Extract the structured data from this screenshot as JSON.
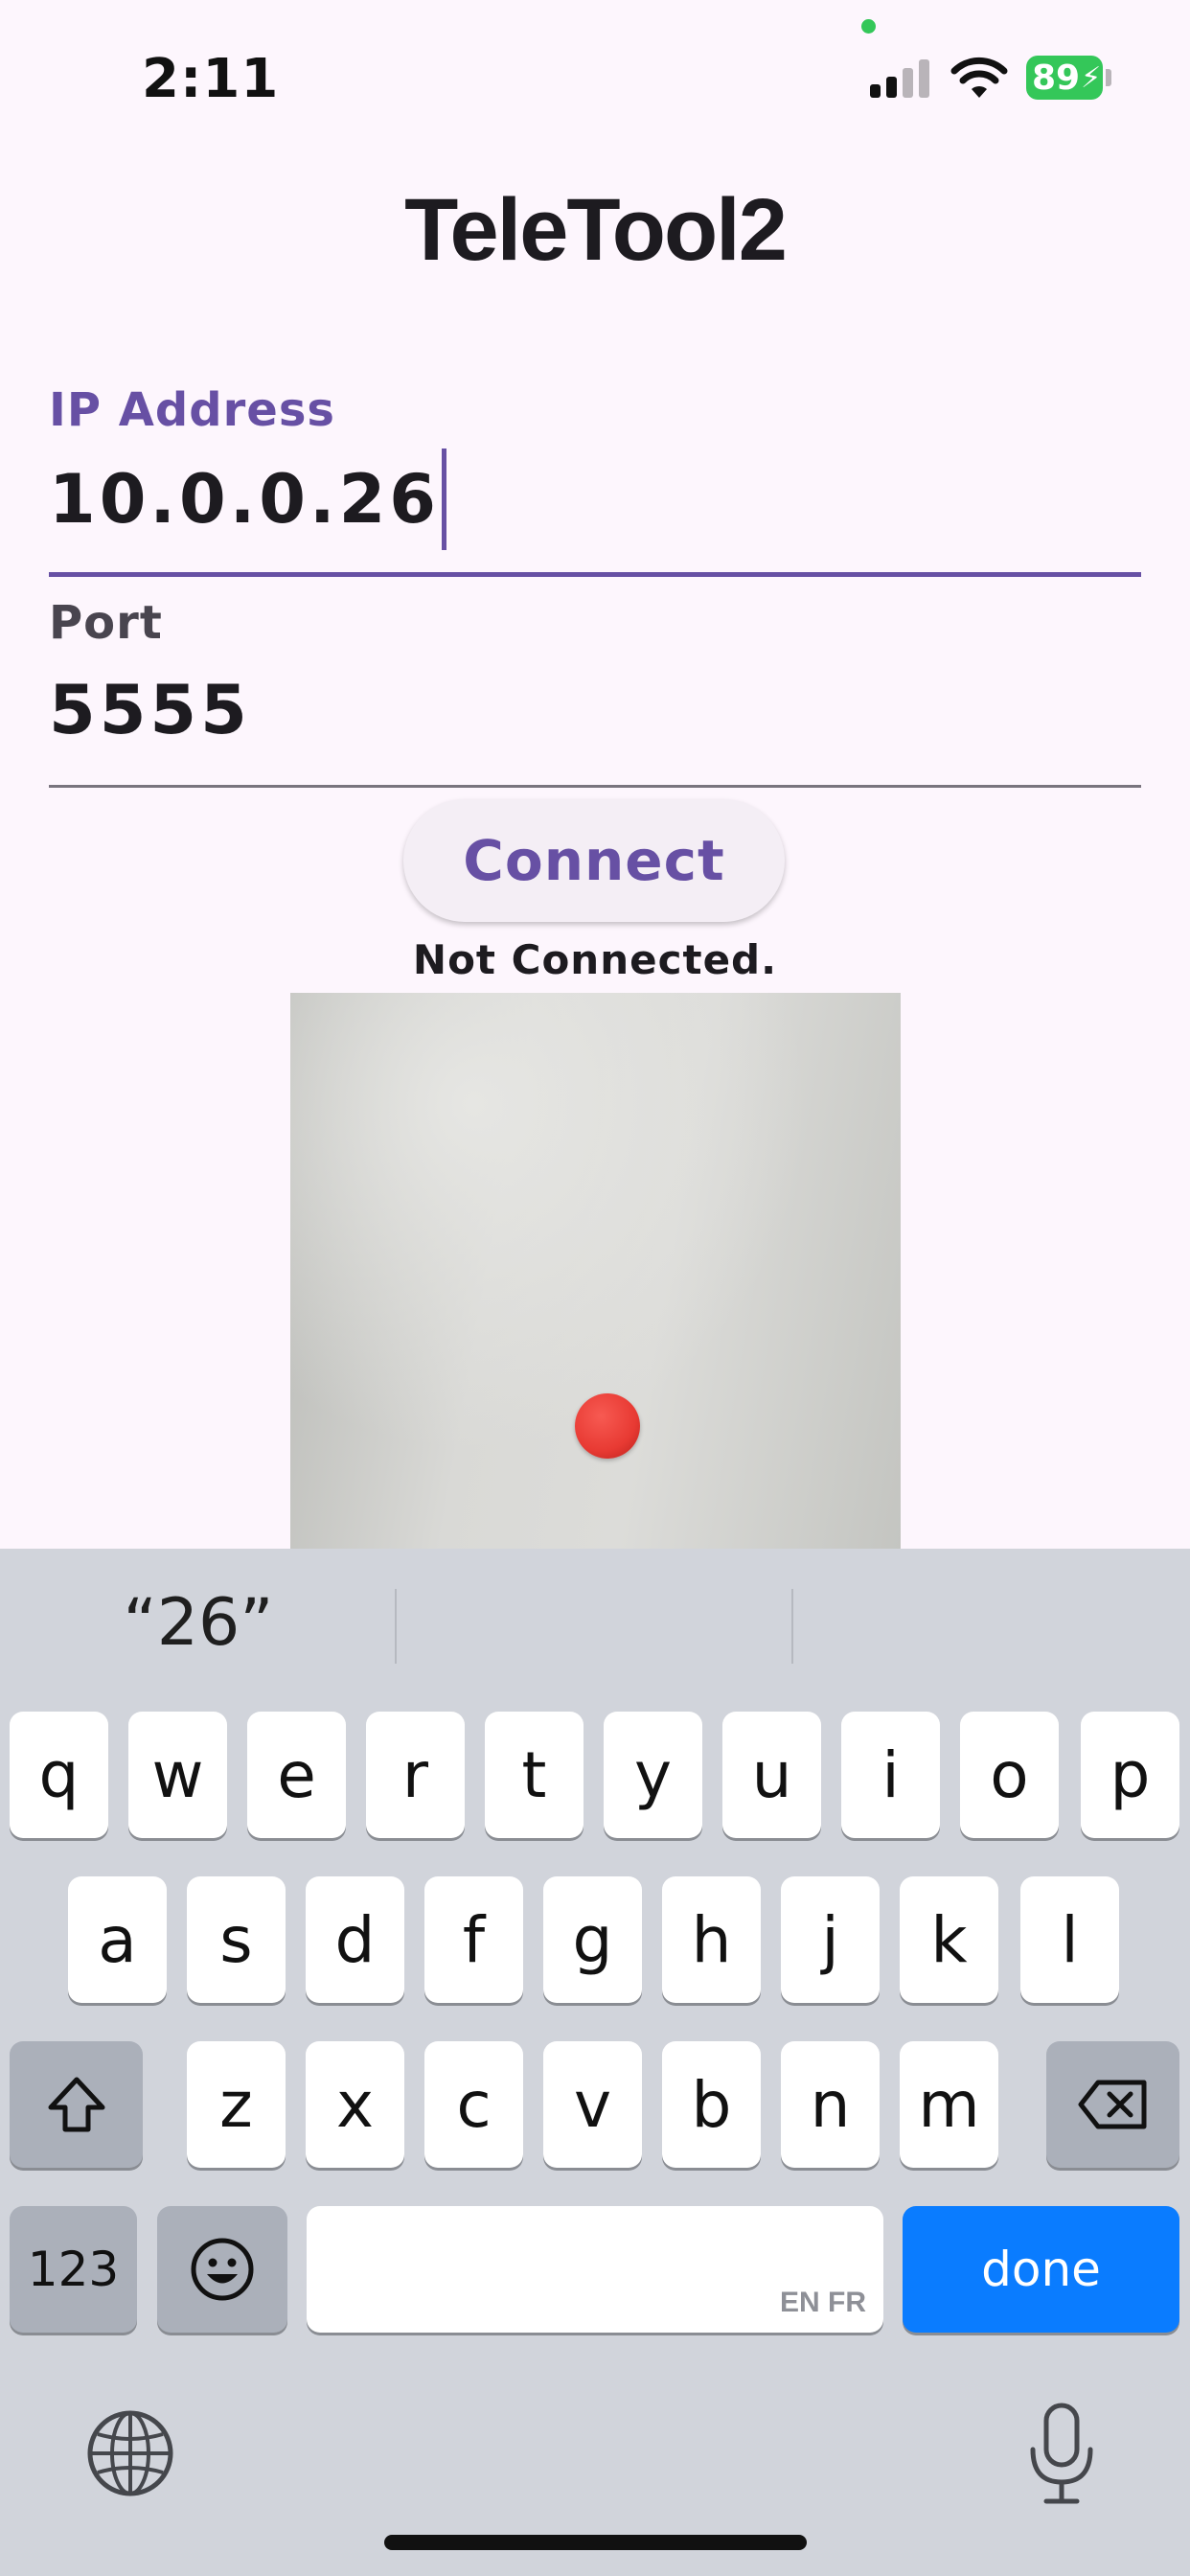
{
  "status_bar": {
    "time": "2:11",
    "battery": "89",
    "battery_color": "#34c759",
    "icons": [
      "signal-icon",
      "wifi-icon",
      "battery-icon",
      "charging-bolt-icon"
    ]
  },
  "app": {
    "title": "TeleTool2",
    "accent_color": "#6750a4",
    "ip_field": {
      "label": "IP Address",
      "value": "10.0.0.26"
    },
    "port_field": {
      "label": "Port",
      "value": "5555"
    },
    "connect_label": "Connect",
    "connection_status": "Not Connected."
  },
  "keyboard": {
    "suggestions": [
      "“26”",
      "",
      ""
    ],
    "row1": [
      "q",
      "w",
      "e",
      "r",
      "t",
      "y",
      "u",
      "i",
      "o",
      "p"
    ],
    "row2": [
      "a",
      "s",
      "d",
      "f",
      "g",
      "h",
      "j",
      "k",
      "l"
    ],
    "row3": [
      "z",
      "x",
      "c",
      "v",
      "b",
      "n",
      "m"
    ],
    "numbers_label": "123",
    "space_hint": "EN FR",
    "done_label": "done",
    "done_color": "#0a7cff",
    "icons": [
      "shift-icon",
      "backspace-icon",
      "emoji-icon",
      "globe-icon",
      "microphone-icon"
    ]
  }
}
